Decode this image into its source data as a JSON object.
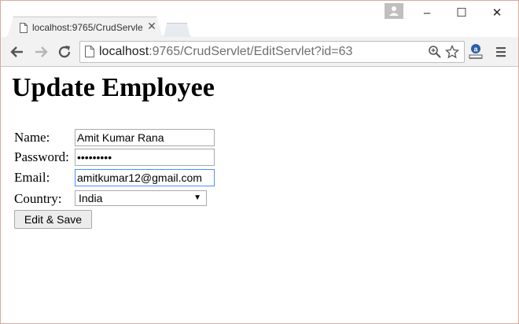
{
  "browser": {
    "tab_title": "localhost:9765/CrudServle",
    "url_host": "localhost",
    "url_rest": ":9765/CrudServlet/EditServlet?id=63",
    "window_controls": {
      "minimize": "–",
      "maximize": "☐",
      "close": "✕"
    },
    "icons": [
      "page-icon",
      "close-icon",
      "back-icon",
      "forward-icon",
      "reload-icon",
      "zoom-icon",
      "star-icon",
      "extension-icon",
      "menu-icon",
      "profile-icon"
    ]
  },
  "page": {
    "heading": "Update Employee",
    "form": {
      "name_label": "Name:",
      "name_value": "Amit Kumar Rana",
      "password_label": "Password:",
      "password_value": "•••••••••",
      "email_label": "Email:",
      "email_value": "amitkumar12@gmail.com",
      "country_label": "Country:",
      "country_value": "India",
      "submit_label": "Edit & Save"
    }
  }
}
